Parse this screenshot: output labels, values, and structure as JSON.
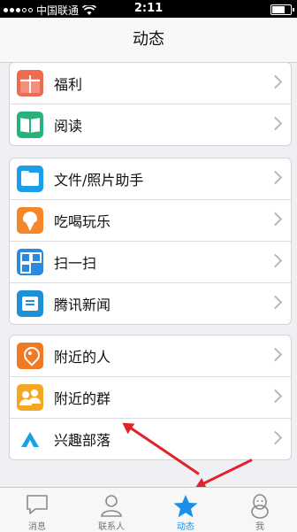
{
  "status_bar": {
    "carrier": "中国联通",
    "time": "2:11",
    "battery_level": 0.8
  },
  "nav": {
    "title": "动态"
  },
  "groups": [
    {
      "items": [
        {
          "label": "福利",
          "icon": "gift-icon",
          "color": "#f06a4f"
        },
        {
          "label": "阅读",
          "icon": "book-icon",
          "color": "#27b27a"
        }
      ]
    },
    {
      "items": [
        {
          "label": "文件/照片助手",
          "icon": "folder-icon",
          "color": "#1a9ee8"
        },
        {
          "label": "吃喝玩乐",
          "icon": "ice-cream-icon",
          "color": "#f6862a"
        },
        {
          "label": "扫一扫",
          "icon": "qr-code-icon",
          "color": "#2a8ae0"
        },
        {
          "label": "腾讯新闻",
          "icon": "news-icon",
          "color": "#1e90d8"
        }
      ]
    },
    {
      "items": [
        {
          "label": "附近的人",
          "icon": "location-pin-icon",
          "color": "#f07a24"
        },
        {
          "label": "附近的群",
          "icon": "nearby-group-icon",
          "color": "#f5a623"
        },
        {
          "label": "兴趣部落",
          "icon": "tent-icon",
          "color": "#1aa0e6"
        }
      ]
    }
  ],
  "tabs": [
    {
      "label": "消息",
      "icon": "message-icon"
    },
    {
      "label": "联系人",
      "icon": "contacts-icon"
    },
    {
      "label": "动态",
      "icon": "star-icon",
      "active": true
    },
    {
      "label": "我",
      "icon": "penguin-icon"
    }
  ],
  "colors": {
    "accent": "#1a8fe8",
    "annotation_arrow": "#e2222a"
  }
}
